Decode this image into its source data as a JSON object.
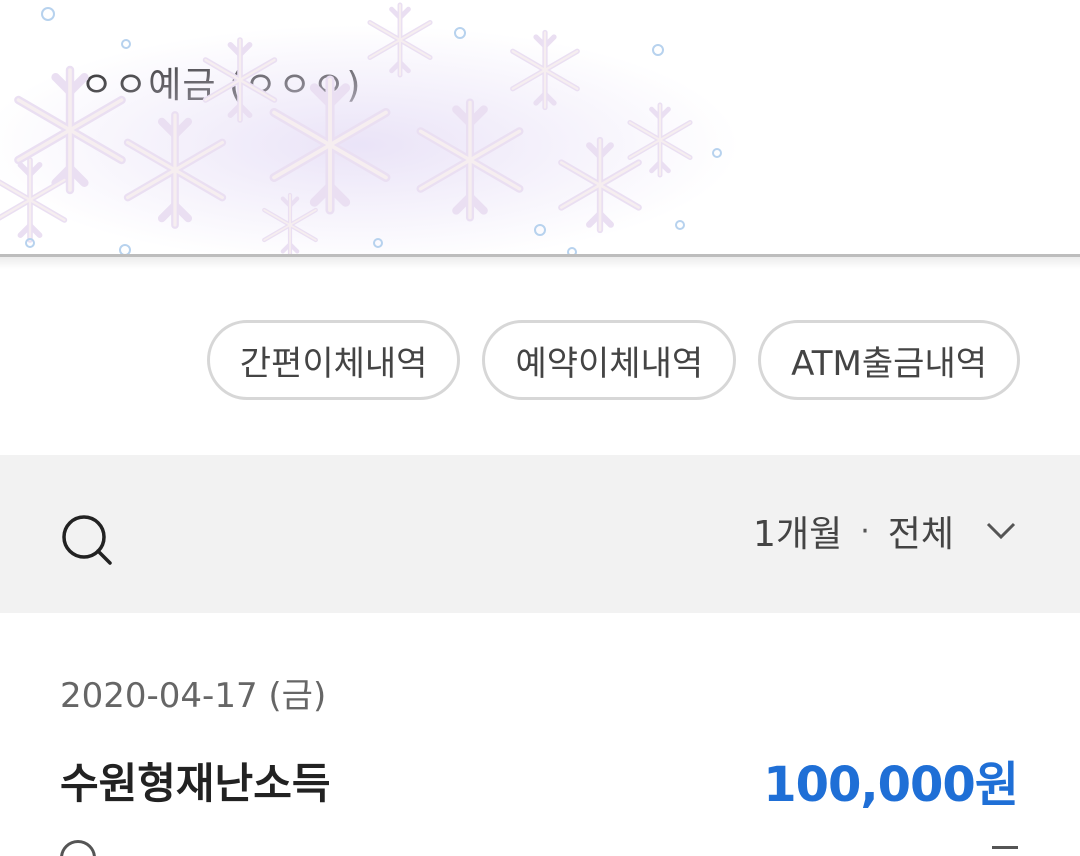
{
  "account": {
    "obscured_text": "ㅇㅇ예금 (ㅇㅇㅇ)"
  },
  "chips": [
    {
      "label": "간편이체내역"
    },
    {
      "label": "예약이체내역"
    },
    {
      "label": "ATM출금내역"
    }
  ],
  "filter": {
    "period": "1개월",
    "separator": "·",
    "type": "전체"
  },
  "transactions": {
    "date": "2020-04-17 (금)",
    "items": [
      {
        "name": "수원형재난소득",
        "amount": "100,000원"
      }
    ]
  },
  "icons": {
    "search": "search-icon",
    "chevron": "chevron-down-icon",
    "decoration": "snowflake-decoration"
  },
  "colors": {
    "amount": "#1f6fd6",
    "filter_bg": "#f2f2f2",
    "chip_border": "#d7d7d7"
  }
}
